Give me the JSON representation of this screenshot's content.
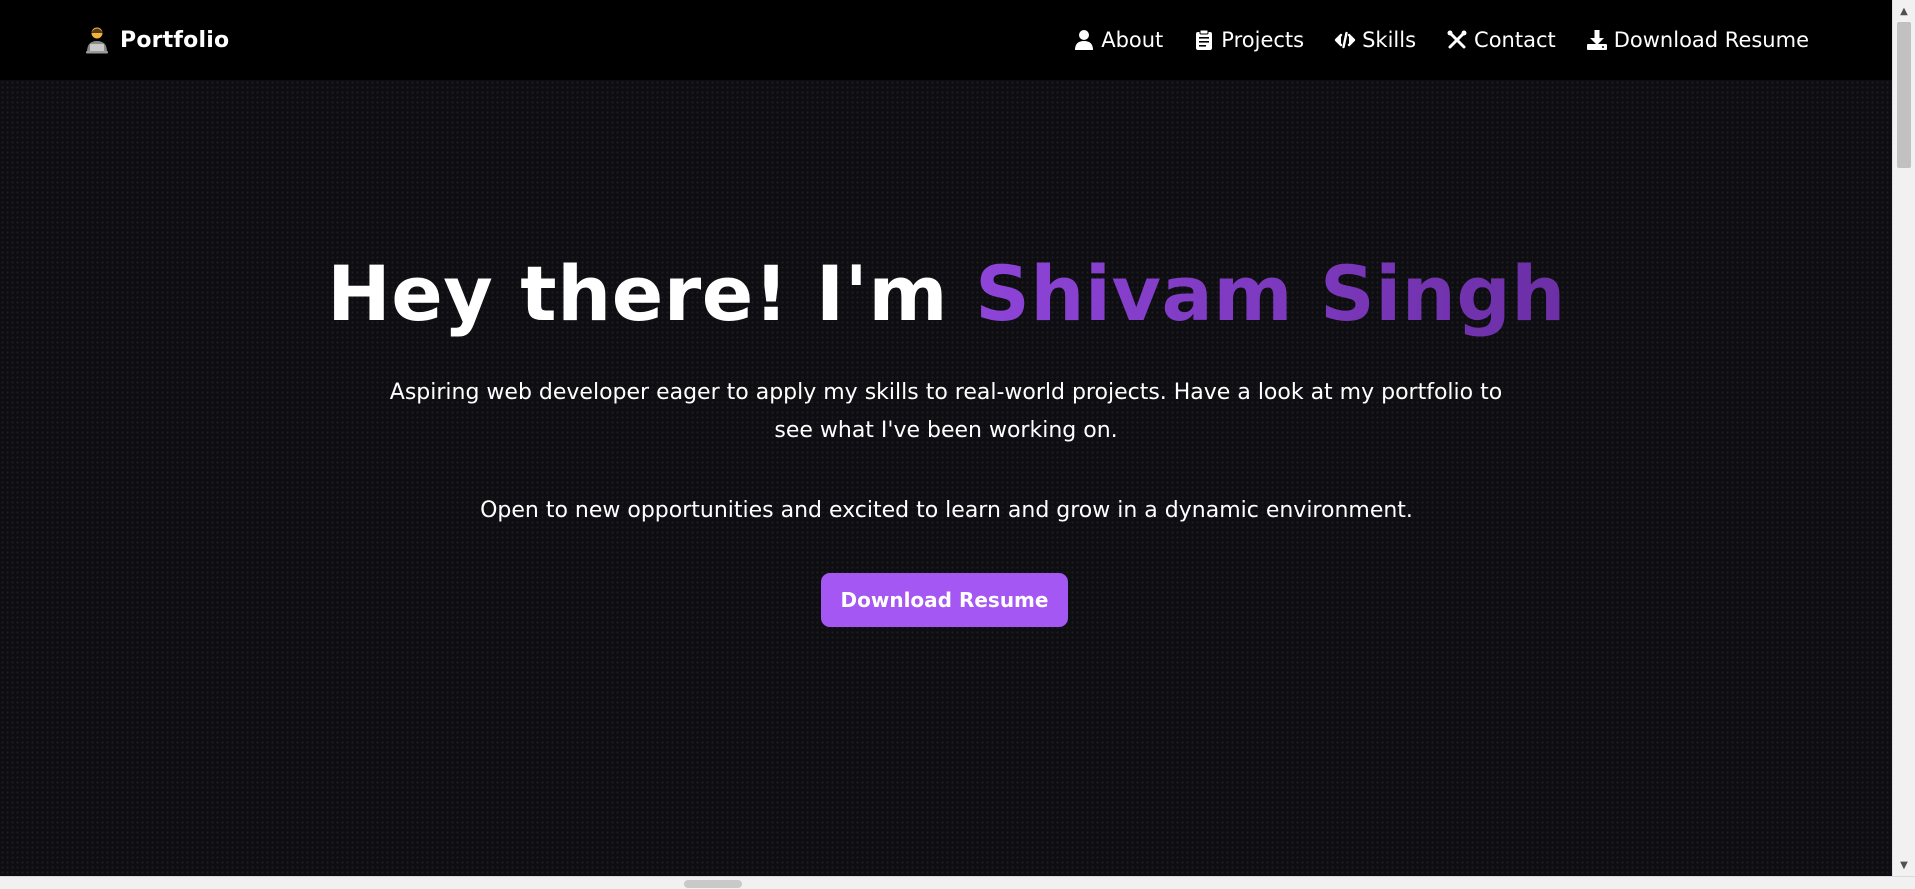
{
  "brand": {
    "icon": "developer-emoji-icon",
    "name": "Portfolio"
  },
  "nav": {
    "items": [
      {
        "label": "About",
        "icon": "user-icon"
      },
      {
        "label": "Projects",
        "icon": "clipboard-icon"
      },
      {
        "label": "Skills",
        "icon": "code-icon"
      },
      {
        "label": "Contact",
        "icon": "tools-icon"
      },
      {
        "label": "Download Resume",
        "icon": "download-icon"
      }
    ]
  },
  "hero": {
    "greeting": "Hey there! I'm ",
    "name": "Shivam Singh",
    "description": "Aspiring web developer eager to apply my skills to real-world projects. Have a look at my portfolio to see what I've been working on.",
    "description2": "Open to new opportunities and excited to learn and grow in a dynamic environment.",
    "cta_label": "Download Resume"
  },
  "colors": {
    "accent": "#a457f2",
    "name_gradient_start": "#8e44d8",
    "name_gradient_end": "#6c2fa5",
    "background": "#0d0d12",
    "navbar": "#000000"
  }
}
